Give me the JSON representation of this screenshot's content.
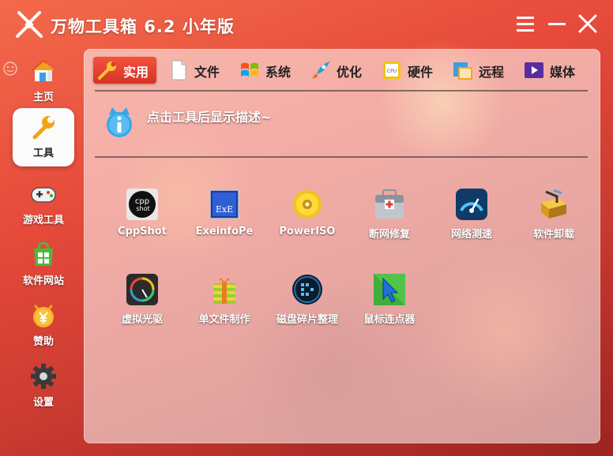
{
  "app": {
    "title": "万物工具箱 6.2 小年版"
  },
  "sidebar": {
    "items": [
      {
        "label": "主页",
        "icon": "home-icon"
      },
      {
        "label": "工具",
        "icon": "wrench-icon",
        "active": true
      },
      {
        "label": "游戏工具",
        "icon": "gamepad-icon"
      },
      {
        "label": "软件网站",
        "icon": "windows-store-icon"
      },
      {
        "label": "赞助",
        "icon": "yuan-coin-icon"
      },
      {
        "label": "设置",
        "icon": "gear-icon"
      }
    ]
  },
  "tabs": [
    {
      "label": "实用",
      "icon": "wrench-icon",
      "active": true
    },
    {
      "label": "文件",
      "icon": "document-icon"
    },
    {
      "label": "系统",
      "icon": "windows-flag-icon"
    },
    {
      "label": "优化",
      "icon": "rocket-icon"
    },
    {
      "label": "硬件",
      "icon": "cpu-icon"
    },
    {
      "label": "远程",
      "icon": "remote-icon"
    },
    {
      "label": "媒体",
      "icon": "play-icon"
    }
  ],
  "info": {
    "text": "点击工具后显示描述~"
  },
  "tools": [
    {
      "label": "CppShot",
      "icon": "cppshot-icon",
      "icon_text": "cpp",
      "icon_sub": "shot"
    },
    {
      "label": "ExeinfoPe",
      "icon": "exeinfope-icon",
      "icon_text": "ExE"
    },
    {
      "label": "PowerISO",
      "icon": "poweriso-disc-icon"
    },
    {
      "label": "断网修复",
      "icon": "network-repair-toolbox-icon"
    },
    {
      "label": "网络测速",
      "icon": "speedometer-icon"
    },
    {
      "label": "软件卸载",
      "icon": "uninstall-box-icon"
    },
    {
      "label": "虚拟光驱",
      "icon": "virtual-drive-icon"
    },
    {
      "label": "单文件制作",
      "icon": "single-file-package-icon"
    },
    {
      "label": "磁盘碎片整理",
      "icon": "defrag-icon"
    },
    {
      "label": "鼠标连点器",
      "icon": "mouse-clicker-icon"
    }
  ]
}
